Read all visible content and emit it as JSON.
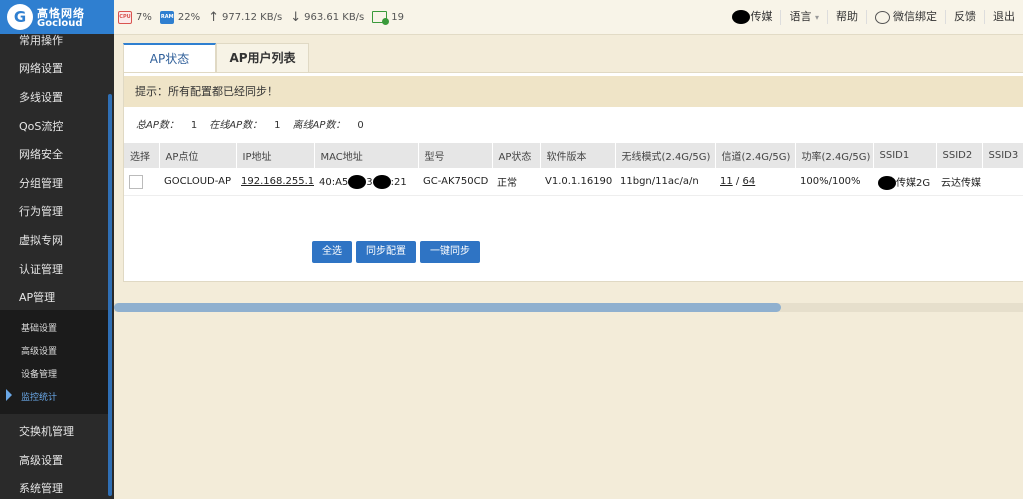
{
  "logo": {
    "cn": "高恪网络",
    "en": "Gocloud"
  },
  "stats": {
    "cpu_label": "CPU",
    "cpu": "7%",
    "ram_label": "RAM",
    "ram": "22%",
    "up": "977.12 KB/s",
    "down": "963.61 KB/s",
    "online": "19"
  },
  "topnav": {
    "user": "传媒",
    "language": "语言",
    "help": "帮助",
    "wechat": "微信绑定",
    "feedback": "反馈",
    "logout": "退出"
  },
  "sidebar": {
    "items": [
      "常用操作",
      "网络设置",
      "多线设置",
      "QoS流控",
      "网络安全",
      "分组管理",
      "行为管理",
      "虚拟专网",
      "认证管理",
      "AP管理"
    ],
    "sub_items": [
      "基础设置",
      "高级设置",
      "设备管理",
      "监控统计"
    ],
    "items_after": [
      "交换机管理",
      "高级设置",
      "系统管理"
    ]
  },
  "tabs": [
    "AP状态",
    "AP用户列表"
  ],
  "notice": "提示：所有配置都已经同步！",
  "summary": {
    "total_label": "总AP数：",
    "total": "1",
    "online_label": "在线AP数：",
    "online": "1",
    "offline_label": "离线AP数：",
    "offline": "0"
  },
  "table": {
    "headers": [
      "选择",
      "AP点位",
      "IP地址",
      "MAC地址",
      "型号",
      "AP状态",
      "软件版本",
      "无线模式(2.4G/5G)",
      "信道(2.4G/5G)",
      "功率(2.4G/5G)",
      "SSID1",
      "SSID2",
      "SSID3"
    ],
    "row": {
      "name": "GOCLOUD-AP",
      "ip": "192.168.255.1",
      "mac_a": "40:A5",
      "mac_b": "3",
      "mac_c": ":21",
      "model": "GC-AK750CD",
      "status": "正常",
      "version": "V1.0.1.16190",
      "mode": "11bgn/11ac/a/n",
      "channel_24": "11",
      "channel_sep": " / ",
      "channel_5": "64",
      "power": "100%/100%",
      "ssid1": "传媒2G",
      "ssid2": "云达传媒",
      "ssid3": ""
    }
  },
  "buttons": {
    "select_all": "全选",
    "sync_config": "同步配置",
    "one_key_sync": "一键同步"
  }
}
